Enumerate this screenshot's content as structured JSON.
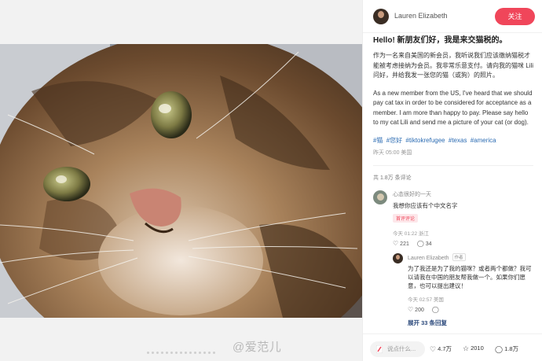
{
  "author": {
    "name": "Lauren Elizabeth",
    "follow_label": "关注"
  },
  "post": {
    "title": "Hello! 新朋友们好，我是来交猫税的。",
    "body_cn": "作为一名来自美国的新会员，我听说我们应该缴纳猫税才能被考虑接纳为会员。我非常乐意支付。请向我的猫咪 Lili 问好，并给我发一张您的猫（或狗）的照片。",
    "body_en": "As a new member from the US, I've heard that we should pay cat tax in order to be considered for acceptance as a member. I am more than happy to pay. Please say hello to my cat Lili and send me a picture of your cat (or dog).",
    "tags": [
      "#猫",
      "#您好",
      "#tiktokrefugee",
      "#texas",
      "#america"
    ],
    "meta": "昨天 05:00 美国"
  },
  "comments": {
    "count_label": "共 1.8万 条评论",
    "items": [
      {
        "name": "心态很好的一天",
        "text": "我想你应该有个中文名字",
        "badge": "首评评论",
        "meta": "今天 01:22 浙江",
        "likes": "221",
        "replies": "34",
        "reply": {
          "name": "Lauren Elizabeth",
          "author_tag": "作者",
          "text": "为了我还是为了我的猫咪？或者两个都做？我可以请我在中国的朋友帮我做一个。如果你们愿意，也可以提出建议！",
          "meta": "今天 02:57 美国",
          "likes": "200",
          "replies_icon": "comment-icon"
        }
      }
    ],
    "expand_label": "展开 33 条回复"
  },
  "bottom": {
    "input_placeholder": "说点什么...",
    "likes": "4.7万",
    "stars": "2010",
    "comments": "1.8万"
  },
  "watermark": "@爱范儿",
  "icons": [
    "heart-icon",
    "star-icon",
    "comment-icon",
    "pen-icon"
  ],
  "colors": {
    "accent": "#f0465a",
    "link": "#2c6cb3"
  }
}
